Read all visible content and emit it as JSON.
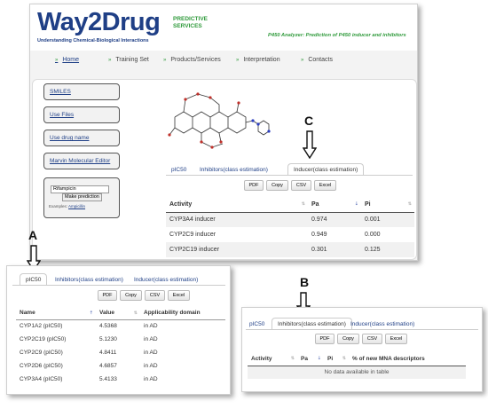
{
  "header": {
    "logo": "Way2Drug",
    "logo_sub_1": "PREDICTIVE",
    "logo_sub_2": "SERVICES",
    "tagline": "Understanding Chemical-Biological Interactions",
    "analyzer_title": "P450 Analyzer: Prediction of P450 inducer and inhibitors"
  },
  "nav": [
    "Home",
    "Training Set",
    "Products/Services",
    "Interpretation",
    "Contacts"
  ],
  "sidebar": {
    "smiles": "SMILES",
    "use_files": "Use Files",
    "use_drug_name": "Use drug name",
    "marvin": "Marvin Molecular Editor",
    "drug_value": "Rifampicin",
    "make_prediction": "Make prediction",
    "examples_label": "Examples:",
    "examples_link": "Ampicillin"
  },
  "tabs": {
    "pic50": "pIC50",
    "inhibitors": "Inhibitors(class estimation)",
    "inducer": "Inducer(class estimation)"
  },
  "buttons": {
    "pdf": "PDF",
    "copy": "Copy",
    "csv": "CSV",
    "excel": "Excel"
  },
  "callouts": {
    "a": "A",
    "b": "B",
    "c": "C"
  },
  "inducer_table": {
    "columns": [
      "Activity",
      "Pa",
      "Pi"
    ],
    "rows": [
      [
        "CYP3A4 inducer",
        "0.974",
        "0.001"
      ],
      [
        "CYP2C9 inducer",
        "0.949",
        "0.000"
      ],
      [
        "CYP2C19 inducer",
        "0.301",
        "0.125"
      ]
    ]
  },
  "pic50_table": {
    "columns": [
      "Name",
      "Value",
      "Applicability domain"
    ],
    "rows": [
      [
        "CYP1A2 (pIC50)",
        "4.5368",
        "in AD"
      ],
      [
        "CYP2C19 (pIC50)",
        "5.1230",
        "in AD"
      ],
      [
        "CYP2C9 (pIC50)",
        "4.8411",
        "in AD"
      ],
      [
        "CYP2D6 (pIC50)",
        "4.6857",
        "in AD"
      ],
      [
        "CYP3A4 (pIC50)",
        "5.4133",
        "in AD"
      ]
    ]
  },
  "inhibitor_table": {
    "columns": [
      "Activity",
      "Pa",
      "Pi",
      "% of new MNA descriptors"
    ],
    "empty_message": "No data available in table"
  },
  "colors": {
    "brand_blue": "#1f3f86",
    "brand_green": "#2f9a3b"
  }
}
